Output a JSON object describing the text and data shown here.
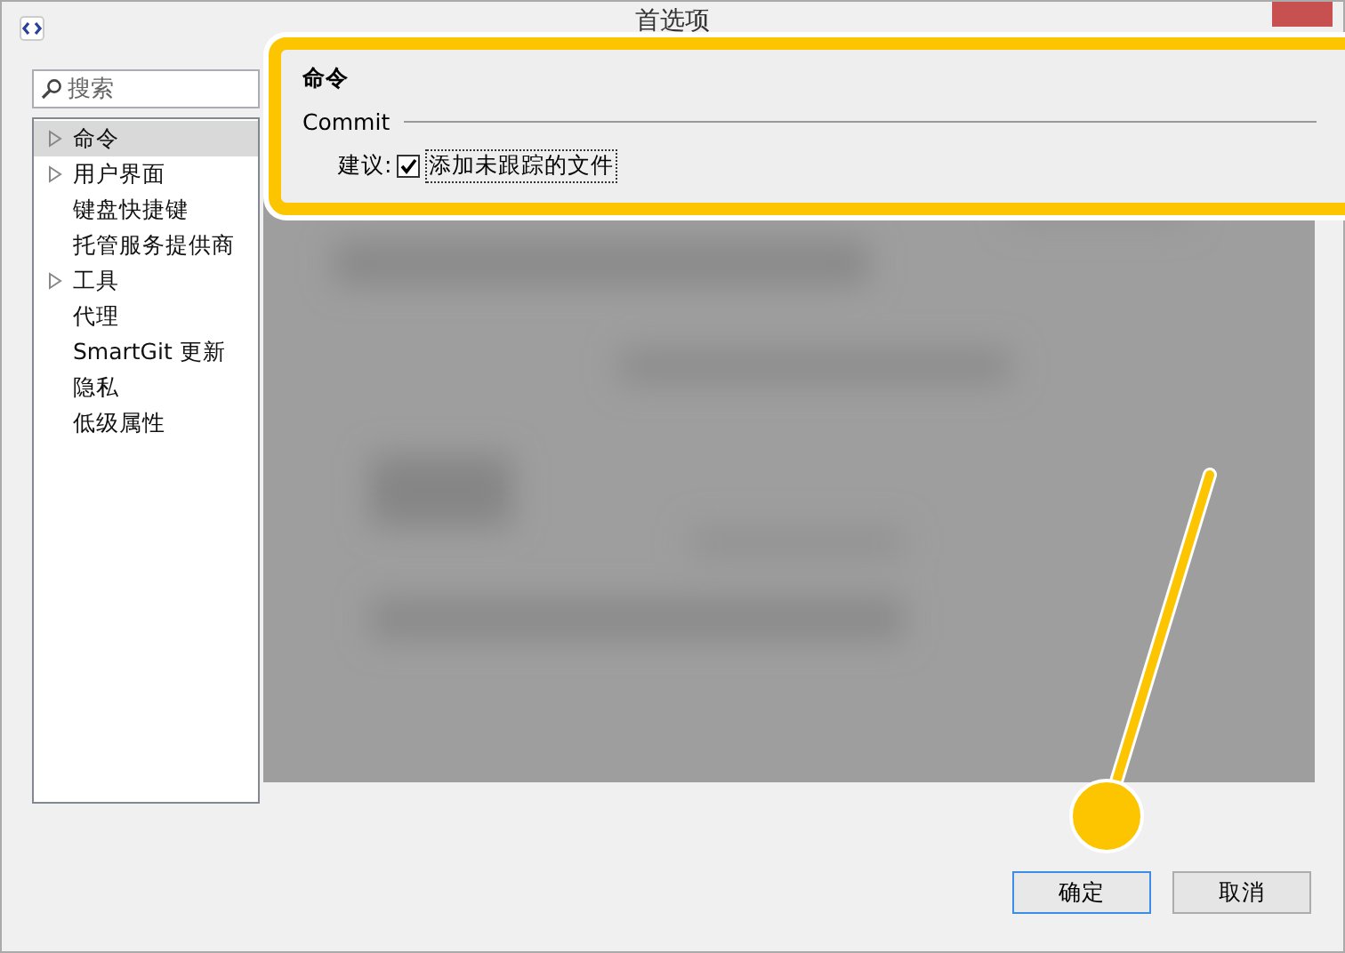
{
  "window": {
    "title": "首选项"
  },
  "search": {
    "placeholder": "搜索"
  },
  "tree": [
    {
      "label": "命令",
      "expandable": true,
      "selected": true
    },
    {
      "label": "用户界面",
      "expandable": true,
      "selected": false
    },
    {
      "label": "键盘快捷键",
      "expandable": false,
      "selected": false
    },
    {
      "label": "托管服务提供商",
      "expandable": false,
      "selected": false
    },
    {
      "label": "工具",
      "expandable": true,
      "selected": false
    },
    {
      "label": "代理",
      "expandable": false,
      "selected": false
    },
    {
      "label": "SmartGit 更新",
      "expandable": false,
      "selected": false
    },
    {
      "label": "隐私",
      "expandable": false,
      "selected": false
    },
    {
      "label": "低级属性",
      "expandable": false,
      "selected": false
    }
  ],
  "callout": {
    "heading": "命令",
    "group": "Commit",
    "row_label": "建议:",
    "option": {
      "label": "添加未跟踪的文件",
      "checked": true
    }
  },
  "buttons": [
    {
      "label": "确定",
      "default": true
    },
    {
      "label": "取消",
      "default": false
    }
  ]
}
